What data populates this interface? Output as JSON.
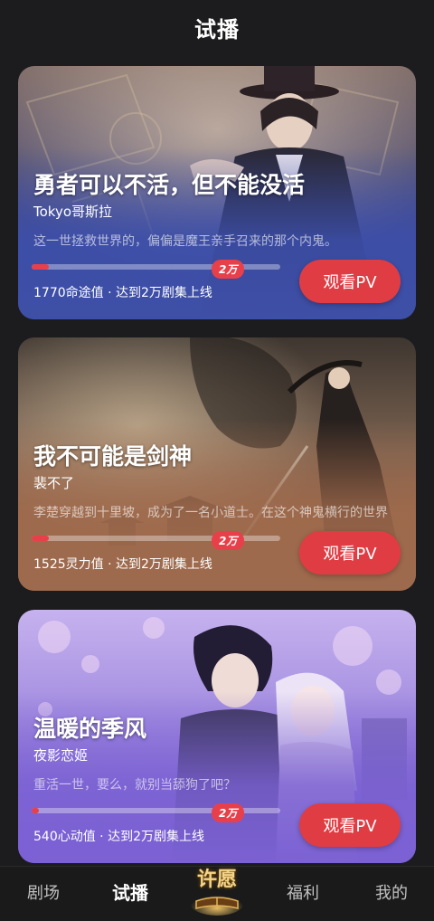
{
  "header": {
    "title": "试播"
  },
  "cards": [
    {
      "title": "勇者可以不活，但不能没活",
      "author": "Tokyo哥斯拉",
      "description": "这一世拯救世界的，偏偏是魔王亲手召来的那个内鬼。",
      "goal_badge": "2万",
      "progress": 0.07,
      "stat": "1770命途值 · 达到2万剧集上线",
      "button": "观看PV",
      "art_top": "#6a5c68",
      "art_bottom": "#3a4a9e"
    },
    {
      "title": "我不可能是剑神",
      "author": "裴不了",
      "description": "李楚穿越到十里坡，成为了一名小道士。在这个神鬼横行的世界",
      "goal_badge": "2万",
      "progress": 0.07,
      "stat": "1525灵力值 · 达到2万剧集上线",
      "button": "观看PV",
      "art_top": "#4a4038",
      "art_bottom": "#9a6a4e"
    },
    {
      "title": "温暖的季风",
      "author": "夜影恋姬",
      "description": "重活一世，要么，就别当舔狗了吧？",
      "goal_badge": "2万",
      "progress": 0.03,
      "stat": "540心动值 · 达到2万剧集上线",
      "button": "观看PV",
      "art_top": "#b9a6e6",
      "art_bottom": "#7d62d4"
    }
  ],
  "nav": {
    "items": [
      {
        "label": "剧场",
        "active": false
      },
      {
        "label": "试播",
        "active": true
      },
      {
        "label": "许愿",
        "active": false
      },
      {
        "label": "福利",
        "active": false
      },
      {
        "label": "我的",
        "active": false
      }
    ]
  }
}
